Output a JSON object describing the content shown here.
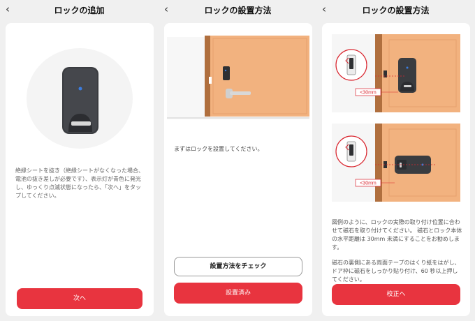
{
  "colors": {
    "accent": "#e8343f",
    "door": "#f2b27f",
    "background": "#f0f0f0"
  },
  "icons": {
    "back": "chevron-left-icon"
  },
  "screen1": {
    "title": "ロックの追加",
    "back_glyph": "‹",
    "description": "絶縁シートを抜き（絶縁シートがなくなった場合、電池の抜き差しが必要です）、表示灯が青色に発光し、ゆっくり点滅状態になったら、「次へ」をタップしてください。",
    "next_button": "次へ"
  },
  "screen2": {
    "title": "ロックの設置方法",
    "back_glyph": "‹",
    "instruction": "まずはロックを設置してください。",
    "check_button": "設置方法をチェック",
    "done_button": "設置済み"
  },
  "screen3": {
    "title": "ロックの設置方法",
    "back_glyph": "‹",
    "distance_label_top": "<30mm",
    "distance_label_bottom": "<30mm",
    "paragraph1": "図例のように、ロックの実際の取り付け位置に合わせて磁石を取り付けてください。 磁石とロック本体の水平距離は 30mm 未満にすることをお勧めします。",
    "paragraph2": "磁石の裏側にある両面テープのはくり紙をはがし、ドア枠に磁石をしっかり貼り付け、60 秒以上押してください。",
    "calibrate_button": "校正へ"
  }
}
